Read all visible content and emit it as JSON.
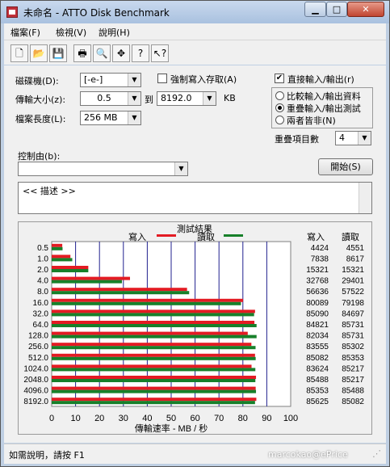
{
  "window": {
    "title": "未命名 - ATTO Disk Benchmark"
  },
  "menu": [
    "檔案(F)",
    "檢視(V)",
    "說明(H)"
  ],
  "toolbar_icons": [
    "new-document-icon",
    "open-folder-icon",
    "save-icon",
    "print-icon",
    "print-preview-icon",
    "move-icon",
    "help-icon",
    "context-help-icon"
  ],
  "settings": {
    "drive_label": "磁碟機(D):",
    "drive_value": "[-e-]",
    "transfer_label": "傳輸大小(z):",
    "transfer_from": "0.5",
    "transfer_to_label": "到",
    "transfer_to": "8192.0",
    "transfer_unit": "KB",
    "length_label": "檔案長度(L):",
    "length_value": "256 MB",
    "force_write_label": "強制寫入存取(A)",
    "direct_io_label": "直接輸入/輸出(r)",
    "radio_compare": "比較輸入/輸出資料",
    "radio_overlap": "重疊輸入/輸出測試",
    "radio_neither": "兩者皆非(N)",
    "queue_label": "重疊項目數",
    "queue_value": "4",
    "controlled_label": "控制由(b):",
    "start_button": "開始(S)",
    "description": "<<   描述   >>"
  },
  "results": {
    "title": "測試結果",
    "legend_write": "寫入",
    "legend_read": "讀取",
    "col_write": "寫入",
    "col_read": "讀取",
    "write_color": "#e31b23",
    "read_color": "#17802a"
  },
  "chart_data": {
    "type": "bar",
    "title": "測試結果",
    "xlabel": "傳輸速率 - MB / 秒",
    "xlim": [
      0,
      100
    ],
    "xticks": [
      "0",
      "10",
      "20",
      "30",
      "40",
      "50",
      "60",
      "70",
      "80",
      "90",
      "100"
    ],
    "categories": [
      "0.5",
      "1.0",
      "2.0",
      "4.0",
      "8.0",
      "16.0",
      "32.0",
      "64.0",
      "128.0",
      "256.0",
      "512.0",
      "1024.0",
      "2048.0",
      "4096.0",
      "8192.0"
    ],
    "series": [
      {
        "name": "寫入",
        "values": [
          4424,
          7838,
          15321,
          32768,
          56636,
          80089,
          85090,
          84821,
          82034,
          83555,
          85082,
          83624,
          85488,
          85353,
          85625
        ]
      },
      {
        "name": "讀取",
        "values": [
          4551,
          8617,
          15321,
          29401,
          57522,
          79198,
          84697,
          85731,
          85731,
          85302,
          85353,
          85217,
          85217,
          85488,
          85082
        ]
      }
    ],
    "write_labels": [
      "4424",
      "7838",
      "15321",
      "32768",
      "56636",
      "80089",
      "85090",
      "84821",
      "82034",
      "83555",
      "85082",
      "83624",
      "85488",
      "85353",
      "85625"
    ],
    "read_labels": [
      "4551",
      "8617",
      "15321",
      "29401",
      "57522",
      "79198",
      "84697",
      "85731",
      "85731",
      "85302",
      "85353",
      "85217",
      "85217",
      "85488",
      "85082"
    ],
    "grid": true,
    "legend_position": "top"
  },
  "status": {
    "text": "如需說明，請按 F1",
    "watermark": "marcokao@ePrice"
  }
}
